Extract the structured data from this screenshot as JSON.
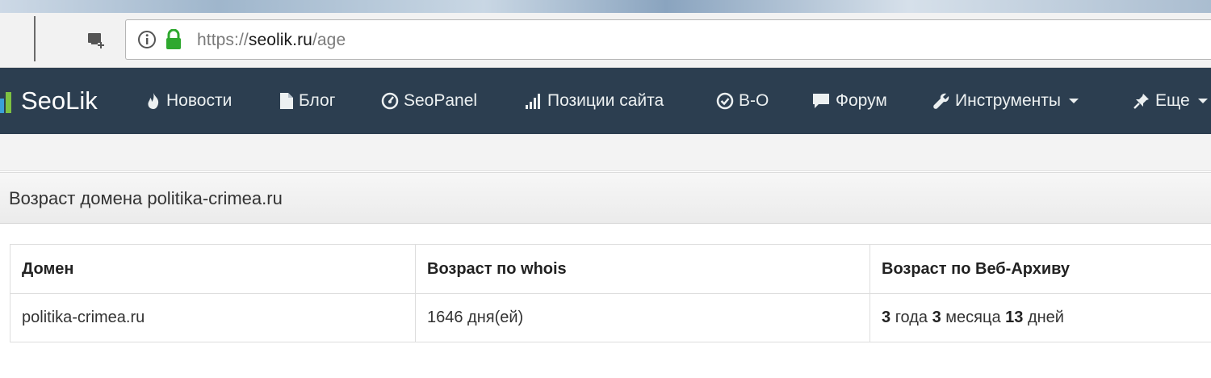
{
  "browser": {
    "url_scheme": "https://",
    "url_host": "seolik.ru",
    "url_path": "/age"
  },
  "navbar": {
    "brand": "SeoLik",
    "items": [
      {
        "label": "Новости",
        "icon": "fire-icon"
      },
      {
        "label": "Блог",
        "icon": "file-icon"
      },
      {
        "label": "SeoPanel",
        "icon": "dashboard-icon"
      },
      {
        "label": "Позиции сайта",
        "icon": "signal-bars-icon"
      },
      {
        "label": "B-O",
        "icon": "check-circle-icon"
      },
      {
        "label": "Форум",
        "icon": "comment-icon"
      },
      {
        "label": "Инструменты",
        "icon": "wrench-icon",
        "dropdown": true
      },
      {
        "label": "Еще",
        "icon": "pushpin-icon",
        "dropdown": true
      }
    ]
  },
  "panel": {
    "title": "Возраст домена politika-crimea.ru"
  },
  "table": {
    "headers": [
      "Домен",
      "Возраст по whois",
      "Возраст по Веб-Архиву"
    ],
    "row": {
      "domain": "politika-crimea.ru",
      "whois_age": "1646 дня(ей)",
      "archive_years": "3",
      "archive_years_unit": "года",
      "archive_months": "3",
      "archive_months_unit": "месяца",
      "archive_days": "13",
      "archive_days_unit": "дней"
    }
  },
  "colors": {
    "navbar_bg": "#2c3e50",
    "lock_green": "#2ea82e"
  }
}
